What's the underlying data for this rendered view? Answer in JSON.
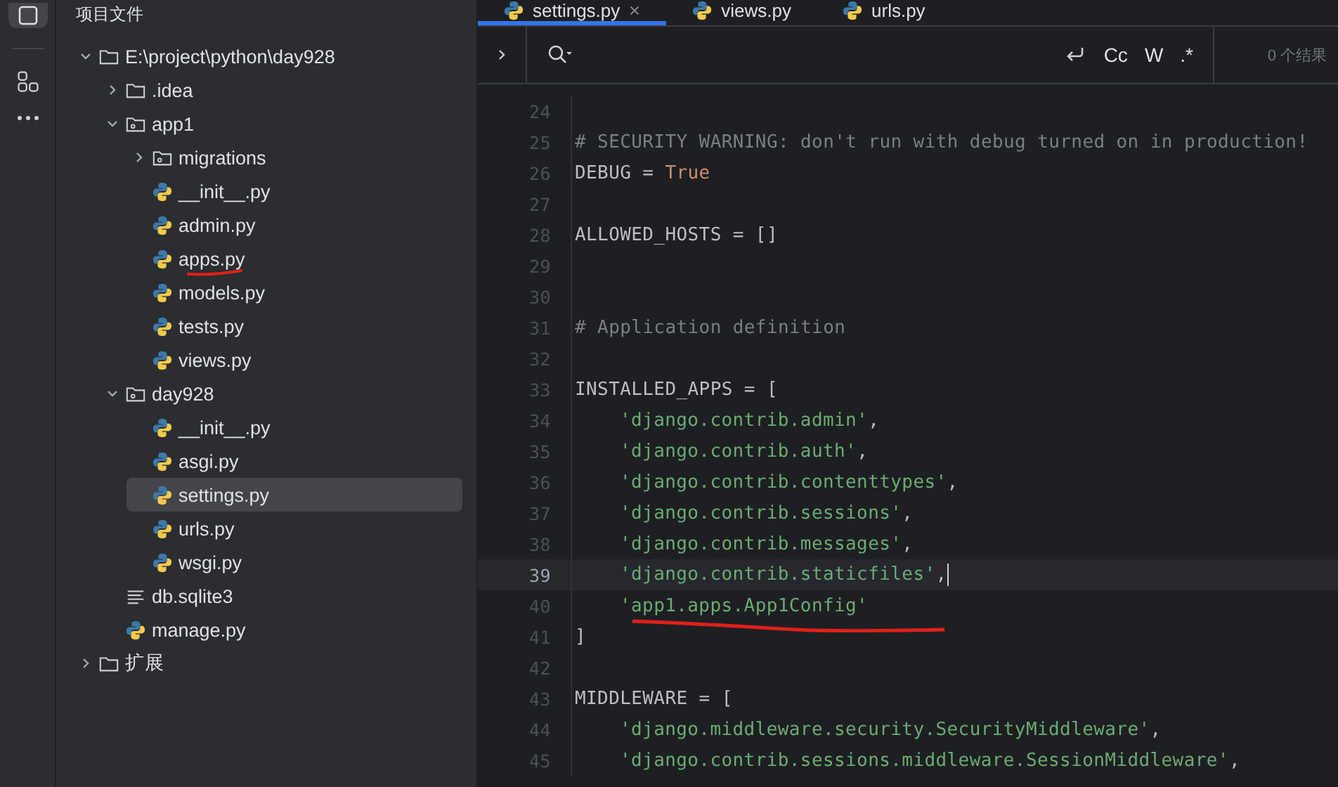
{
  "project_panel": {
    "title": "项目文件",
    "tree": [
      {
        "label": "E:\\project\\python\\day928",
        "kind": "folder",
        "expanded": true,
        "selected": false,
        "children": [
          {
            "label": ".idea",
            "kind": "folder",
            "expanded": false,
            "selected": false
          },
          {
            "label": "app1",
            "kind": "module",
            "expanded": true,
            "selected": false,
            "children": [
              {
                "label": "migrations",
                "kind": "module",
                "expanded": false,
                "selected": false
              },
              {
                "label": "__init__.py",
                "kind": "python",
                "selected": false,
                "underlined": false
              },
              {
                "label": "admin.py",
                "kind": "python",
                "selected": false,
                "underlined": false
              },
              {
                "label": "apps.py",
                "kind": "python",
                "selected": false,
                "underlined": true
              },
              {
                "label": "models.py",
                "kind": "python",
                "selected": false,
                "underlined": false
              },
              {
                "label": "tests.py",
                "kind": "python",
                "selected": false,
                "underlined": false
              },
              {
                "label": "views.py",
                "kind": "python",
                "selected": false,
                "underlined": false
              }
            ]
          },
          {
            "label": "day928",
            "kind": "module",
            "expanded": true,
            "selected": false,
            "children": [
              {
                "label": "__init__.py",
                "kind": "python",
                "selected": false,
                "underlined": false
              },
              {
                "label": "asgi.py",
                "kind": "python",
                "selected": false,
                "underlined": false
              },
              {
                "label": "settings.py",
                "kind": "python",
                "selected": true,
                "underlined": false
              },
              {
                "label": "urls.py",
                "kind": "python",
                "selected": false,
                "underlined": false
              },
              {
                "label": "wsgi.py",
                "kind": "python",
                "selected": false,
                "underlined": false
              }
            ]
          },
          {
            "label": "db.sqlite3",
            "kind": "text",
            "selected": false,
            "underlined": false
          },
          {
            "label": "manage.py",
            "kind": "python",
            "selected": false,
            "underlined": false
          }
        ]
      },
      {
        "label": "扩展",
        "kind": "folder",
        "expanded": false,
        "selected": false
      }
    ]
  },
  "tabs": [
    {
      "label": "settings.py",
      "selected": true,
      "closable": true
    },
    {
      "label": "views.py",
      "selected": false,
      "closable": false
    },
    {
      "label": "urls.py",
      "selected": false,
      "closable": false
    }
  ],
  "search_bar": {
    "options": [
      "Cc",
      "W",
      ".*"
    ],
    "result": "0 个结果"
  },
  "code": [
    {
      "number": "24",
      "current": false,
      "underlined": false
    },
    {
      "number": "25",
      "current": false,
      "underlined": false,
      "tokens": [
        {
          "kind": "comment",
          "text": "# SECURITY WARNING: don't run with debug turned on in production!"
        }
      ]
    },
    {
      "number": "26",
      "current": false,
      "underlined": false,
      "tokens": [
        {
          "kind": "plain",
          "text": "DEBUG ="
        },
        {
          "kind": "keyword",
          "text": "True"
        }
      ]
    },
    {
      "number": "27",
      "current": false,
      "underlined": false
    },
    {
      "number": "28",
      "current": false,
      "underlined": false,
      "tokens": [
        {
          "kind": "plain",
          "text": "ALLOWED_HOSTS = []"
        }
      ]
    },
    {
      "number": "29",
      "current": false,
      "underlined": false
    },
    {
      "number": "30",
      "current": false,
      "underlined": false
    },
    {
      "number": "31",
      "current": false,
      "underlined": false,
      "tokens": [
        {
          "kind": "comment",
          "text": "# Application definition"
        }
      ]
    },
    {
      "number": "32",
      "current": false,
      "underlined": false
    },
    {
      "number": "33",
      "current": false,
      "underlined": false,
      "tokens": [
        {
          "kind": "plain",
          "text": "INSTALLED_APPS = ["
        }
      ]
    },
    {
      "number": "34",
      "current": false,
      "underlined": false,
      "indented": true,
      "tokens": [
        {
          "kind": "string",
          "text": "'django.contrib.admin'"
        },
        {
          "kind": "plain",
          "text": ","
        }
      ]
    },
    {
      "number": "35",
      "current": false,
      "underlined": false,
      "indented": true,
      "tokens": [
        {
          "kind": "string",
          "text": "'django.contrib.auth'"
        },
        {
          "kind": "plain",
          "text": ","
        }
      ]
    },
    {
      "number": "36",
      "current": false,
      "underlined": false,
      "indented": true,
      "tokens": [
        {
          "kind": "string",
          "text": "'django.contrib.contenttypes'"
        },
        {
          "kind": "plain",
          "text": ","
        }
      ]
    },
    {
      "number": "37",
      "current": false,
      "underlined": false,
      "indented": true,
      "tokens": [
        {
          "kind": "string",
          "text": "'django.contrib.sessions'"
        },
        {
          "kind": "plain",
          "text": ","
        }
      ]
    },
    {
      "number": "38",
      "current": false,
      "underlined": false,
      "indented": true,
      "tokens": [
        {
          "kind": "string",
          "text": "'django.contrib.messages'"
        },
        {
          "kind": "plain",
          "text": ","
        }
      ]
    },
    {
      "number": "39",
      "current": true,
      "underlined": false,
      "indented": true,
      "tokens": [
        {
          "kind": "string",
          "text": "'django.contrib.staticfiles'"
        },
        {
          "kind": "plain",
          "text": ","
        }
      ]
    },
    {
      "number": "40",
      "current": false,
      "underlined": true,
      "indented": true,
      "tokens": [
        {
          "kind": "string",
          "text": "'app1.apps.App1Config'"
        }
      ]
    },
    {
      "number": "41",
      "current": false,
      "underlined": false,
      "tokens": [
        {
          "kind": "plain",
          "text": "]"
        }
      ]
    },
    {
      "number": "42",
      "current": false,
      "underlined": false
    },
    {
      "number": "43",
      "current": false,
      "underlined": false,
      "tokens": [
        {
          "kind": "plain",
          "text": "MIDDLEWARE = ["
        }
      ]
    },
    {
      "number": "44",
      "current": false,
      "underlined": false,
      "indented": true,
      "tokens": [
        {
          "kind": "string",
          "text": "'django.middleware.security.SecurityMiddleware'"
        },
        {
          "kind": "plain",
          "text": ","
        }
      ]
    },
    {
      "number": "45",
      "current": false,
      "underlined": false,
      "indented": true,
      "tokens": [
        {
          "kind": "string",
          "text": "'django.contrib.sessions.middleware.SessionMiddleware'"
        },
        {
          "kind": "plain",
          "text": ","
        }
      ]
    }
  ]
}
